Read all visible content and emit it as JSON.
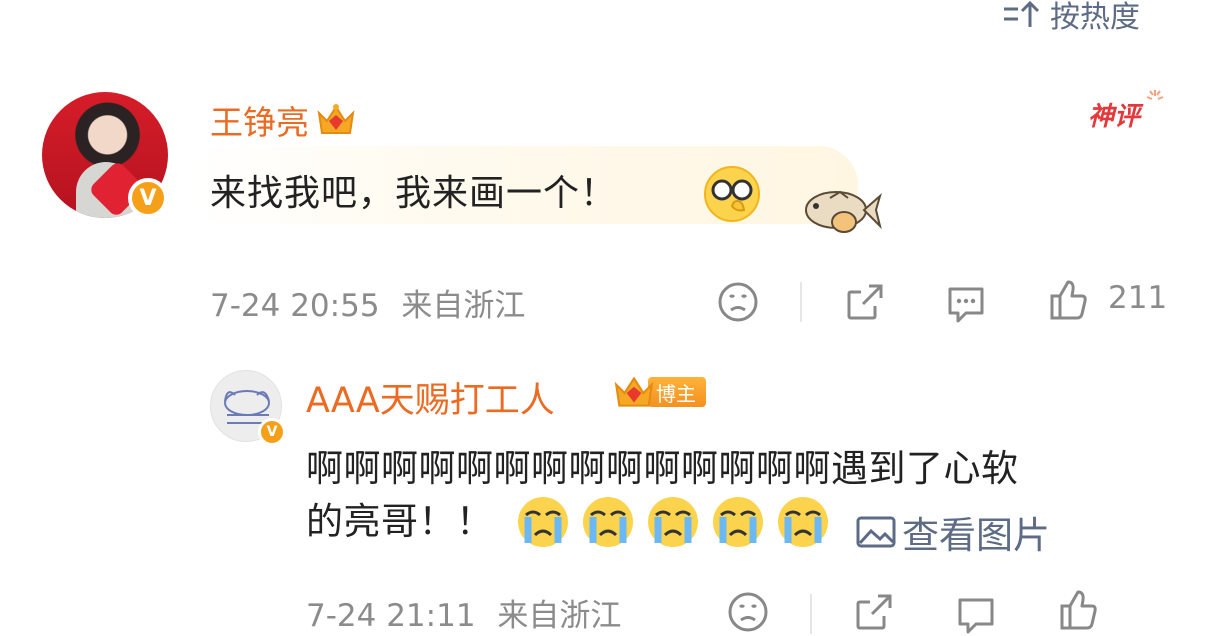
{
  "sort": {
    "label": "按热度"
  },
  "main_comment": {
    "username": "王铮亮",
    "badge": "神评",
    "text": "来找我吧，我来画一个！",
    "timestamp": "7-24 20:55",
    "location": "来自浙江",
    "likes": "211"
  },
  "reply": {
    "username": "AAA天赐打工人",
    "role_badge": "博主",
    "text_line1": "啊啊啊啊啊啊啊啊啊啊啊啊啊啊遇到了心软",
    "text_line2": "的亮哥！！",
    "view_image_label": "查看图片",
    "timestamp": "7-24 21:11",
    "location": "来自浙江"
  },
  "colors": {
    "username": "#ea6b21",
    "meta": "#8b8b8b",
    "link": "#5d6b86",
    "verified": "#f6a01a"
  },
  "icons": [
    "sort-icon",
    "crown-icon",
    "shenping-icon",
    "glasses-emoji-icon",
    "fish-sticker-icon",
    "dislike-icon",
    "share-icon",
    "comment-icon",
    "like-icon",
    "crying-emoji-icon",
    "image-icon"
  ]
}
